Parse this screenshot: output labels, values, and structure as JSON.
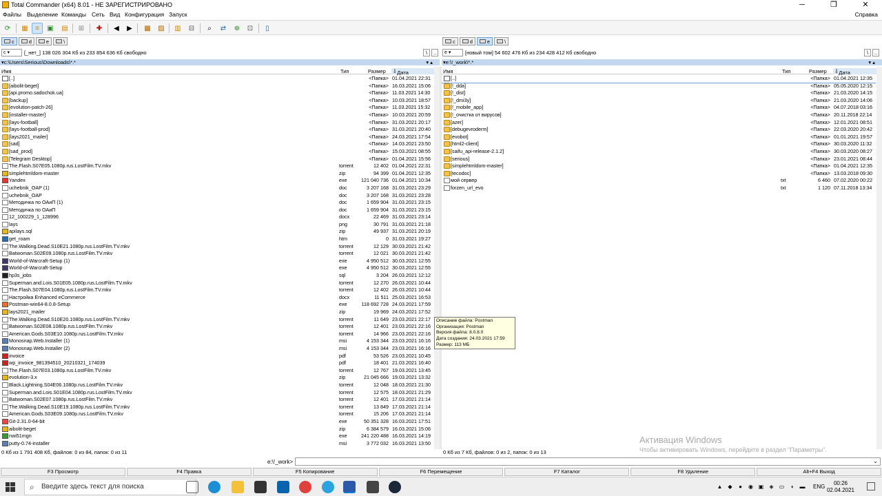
{
  "window": {
    "title": "Total Commander (x64) 8.01 - НЕ ЗАРЕГИСТРИРОВАНО",
    "minimize": "─",
    "maximize": "❐",
    "close": "✕"
  },
  "menu": [
    "Файлы",
    "Выделение",
    "Команды",
    "Сеть",
    "Вид",
    "Конфигурация",
    "Запуск"
  ],
  "help_menu": "Справка",
  "toolbar_icons": [
    "refresh-icon",
    "thumbnails-icon",
    "detail-view-icon",
    "tree-view-icon",
    "folder-sync-icon",
    "filter-icon",
    "invert-selection-icon",
    "back-arrow-icon",
    "forward-arrow-icon",
    "pack-icon",
    "unpack-icon",
    "multi-rename-icon",
    "compare-icon",
    "find-icon",
    "sync-dirs-icon",
    "ftp-icon",
    "url-icon",
    "notepad-icon"
  ],
  "left": {
    "drives": [
      "c",
      "d",
      "e",
      "\\"
    ],
    "selected_drive": "c",
    "drive_select": "c",
    "volume_info": "[_нет_]  138 026 304 Кб из 233 854 636 Кб свободно",
    "root_btn": "\\",
    "up_btn": "..",
    "path": "c:\\Users\\Serious\\Downloads\\*.*",
    "cols": {
      "name": "Имя",
      "ext": "Тип",
      "size": "Размер",
      "date": "Дата"
    },
    "rows": [
      {
        "n": "[..]",
        "e": "",
        "s": "<Папка>",
        "d": "01.04.2021 22:31",
        "t": "up"
      },
      {
        "n": "[aibolit-beget]",
        "e": "",
        "s": "<Папка>",
        "d": "16.03.2021 15:06",
        "t": "folder"
      },
      {
        "n": "[api.promo.sadochok.ua]",
        "e": "",
        "s": "<Папка>",
        "d": "11.03.2021 14:30",
        "t": "folder"
      },
      {
        "n": "[backup]",
        "e": "",
        "s": "<Папка>",
        "d": "10.03.2021 18:57",
        "t": "folder"
      },
      {
        "n": "[evolution-patch-26]",
        "e": "",
        "s": "<Папка>",
        "d": "11.03.2021 15:32",
        "t": "folder"
      },
      {
        "n": "[installer-master]",
        "e": "",
        "s": "<Папка>",
        "d": "10.03.2021 20:59",
        "t": "folder"
      },
      {
        "n": "[lays-football]",
        "e": "",
        "s": "<Папка>",
        "d": "31.03.2021 20:17",
        "t": "folder"
      },
      {
        "n": "[lays-football-prod]",
        "e": "",
        "s": "<Папка>",
        "d": "31.03.2021 20:40",
        "t": "folder"
      },
      {
        "n": "[lays2021_mailer]",
        "e": "",
        "s": "<Папка>",
        "d": "24.03.2021 17:54",
        "t": "folder"
      },
      {
        "n": "[sad]",
        "e": "",
        "s": "<Папка>",
        "d": "14.03.2021 23:50",
        "t": "folder"
      },
      {
        "n": "[sad_prod]",
        "e": "",
        "s": "<Папка>",
        "d": "15.03.2021 08:55",
        "t": "folder"
      },
      {
        "n": "[Telegram Desktop]",
        "e": "",
        "s": "<Папка>",
        "d": "01.04.2021 15:56",
        "t": "folder"
      },
      {
        "n": "The.Flash.S07E05.1080p.rus.LostFilm.TV.mkv",
        "e": "torrent",
        "s": "12 402",
        "d": "01.04.2021 22:31",
        "t": "file"
      },
      {
        "n": "simplehtmldom-master",
        "e": "zip",
        "s": "94 399",
        "d": "01.04.2021 12:35",
        "t": "zip"
      },
      {
        "n": "Yandex",
        "e": "exe",
        "s": "121 040 736",
        "d": "01.04.2021 10:34",
        "t": "yandex"
      },
      {
        "n": "uchebnik_OAP (1)",
        "e": "doc",
        "s": "3 207 168",
        "d": "31.03.2021 23:29",
        "t": "file"
      },
      {
        "n": "uchebnik_OAP",
        "e": "doc",
        "s": "3 207 168",
        "d": "31.03.2021 23:28",
        "t": "file"
      },
      {
        "n": "Методичка по ОАиП (1)",
        "e": "doc",
        "s": "1 659 904",
        "d": "31.03.2021 23:15",
        "t": "file"
      },
      {
        "n": "Методичка по ОАиП",
        "e": "doc",
        "s": "1 659 904",
        "d": "31.03.2021 23:15",
        "t": "file"
      },
      {
        "n": "12_100229_1_128996",
        "e": "docx",
        "s": "22 469",
        "d": "31.03.2021 23:14",
        "t": "file"
      },
      {
        "n": "lays",
        "e": "png",
        "s": "30 791",
        "d": "31.03.2021 21:18",
        "t": "file"
      },
      {
        "n": "apilays.sql",
        "e": "zip",
        "s": "49 937",
        "d": "31.03.2021 20:19",
        "t": "zip"
      },
      {
        "n": "get_roam",
        "e": "htm",
        "s": "0",
        "d": "31.03.2021 19:27",
        "t": "htm"
      },
      {
        "n": "The.Walking.Dead.S10E21.1080p.rus.LostFilm.TV.mkv",
        "e": "torrent",
        "s": "12 129",
        "d": "30.03.2021 21:42",
        "t": "file"
      },
      {
        "n": "Batwoman.S02E09.1080p.rus.LostFilm.TV.mkv",
        "e": "torrent",
        "s": "12 021",
        "d": "30.03.2021 21:42",
        "t": "file"
      },
      {
        "n": "World-of-Warcraft-Setup (1)",
        "e": "exe",
        "s": "4 950 512",
        "d": "30.03.2021 12:55",
        "t": "wow"
      },
      {
        "n": "World-of-Warcraft-Setup",
        "e": "exe",
        "s": "4 950 512",
        "d": "30.03.2021 12:55",
        "t": "wow"
      },
      {
        "n": "hp3s_jobs",
        "e": "sql",
        "s": "3 204",
        "d": "26.03.2021 12:12",
        "t": "sql"
      },
      {
        "n": "Superman.and.Lois.S01E05.1080p.rus.LostFilm.TV.mkv",
        "e": "torrent",
        "s": "12 270",
        "d": "26.03.2021 10:44",
        "t": "file"
      },
      {
        "n": "The.Flash.S07E04.1080p.rus.LostFilm.TV.mkv",
        "e": "torrent",
        "s": "12 402",
        "d": "26.03.2021 10:44",
        "t": "file"
      },
      {
        "n": "Настройка Enhanced eCommerce",
        "e": "docx",
        "s": "11 511",
        "d": "25.03.2021 16:53",
        "t": "file"
      },
      {
        "n": "Postman-win64-8.0.8-Setup",
        "e": "exe",
        "s": "118 692 728",
        "d": "24.03.2021 17:59",
        "t": "postman"
      },
      {
        "n": "lays2021_mailer",
        "e": "zip",
        "s": "19 969",
        "d": "24.03.2021 17:52",
        "t": "zip"
      },
      {
        "n": "The.Walking.Dead.S10E20.1080p.rus.LostFilm.TV.mkv",
        "e": "torrent",
        "s": "11 649",
        "d": "23.03.2021 22:17",
        "t": "file"
      },
      {
        "n": "Batwoman.S02E08.1080p.rus.LostFilm.TV.mkv",
        "e": "torrent",
        "s": "12 401",
        "d": "23.03.2021 22:16",
        "t": "file"
      },
      {
        "n": "American.Gods.S03E10.1080p.rus.LostFilm.TV.mkv",
        "e": "torrent",
        "s": "14 966",
        "d": "23.03.2021 22:16",
        "t": "file"
      },
      {
        "n": "Monosnap.Web.Installer (1)",
        "e": "msi",
        "s": "4 153 344",
        "d": "23.03.2021 16:16",
        "t": "msi"
      },
      {
        "n": "Monosnap.Web.Installer (2)",
        "e": "msi",
        "s": "4 153 344",
        "d": "23.03.2021 16:16",
        "t": "msi"
      },
      {
        "n": "invoice",
        "e": "pdf",
        "s": "53 526",
        "d": "23.03.2021 10:45",
        "t": "pdf"
      },
      {
        "n": "wp_invoice_981394510_20210321_174039",
        "e": "pdf",
        "s": "18 401",
        "d": "21.03.2021 16:40",
        "t": "pdf"
      },
      {
        "n": "The.Flash.S07E03.1080p.rus.LostFilm.TV.mkv",
        "e": "torrent",
        "s": "12 767",
        "d": "19.03.2021 13:45",
        "t": "file"
      },
      {
        "n": "evolution-3.x",
        "e": "zip",
        "s": "21 045 666",
        "d": "19.03.2021 13:32",
        "t": "zip"
      },
      {
        "n": "Black.Lightning.S04E06.1080p.rus.LostFilm.TV.mkv",
        "e": "torrent",
        "s": "12 048",
        "d": "18.03.2021 21:30",
        "t": "file"
      },
      {
        "n": "Superman.and.Lois.S01E04.1080p.rus.LostFilm.TV.mkv",
        "e": "torrent",
        "s": "12 575",
        "d": "18.03.2021 21:29",
        "t": "file"
      },
      {
        "n": "Batwoman.S02E07.1080p.rus.LostFilm.TV.mkv",
        "e": "torrent",
        "s": "12 401",
        "d": "17.03.2021 21:14",
        "t": "file"
      },
      {
        "n": "The.Walking.Dead.S10E19.1080p.rus.LostFilm.TV.mkv",
        "e": "torrent",
        "s": "13 849",
        "d": "17.03.2021 21:14",
        "t": "file"
      },
      {
        "n": "American.Gods.S03E09.1080p.rus.LostFilm.TV.mkv",
        "e": "torrent",
        "s": "15 206",
        "d": "17.03.2021 21:14",
        "t": "file"
      },
      {
        "n": "Git-2.31.0-64-bit",
        "e": "exe",
        "s": "50 351 328",
        "d": "16.03.2021 17:51",
        "t": "git"
      },
      {
        "n": "aibolit-beget",
        "e": "zip",
        "s": "6 384 579",
        "d": "16.03.2021 15:06",
        "t": "zip"
      },
      {
        "n": "nwi51mgn",
        "e": "exe",
        "s": "241 220 488",
        "d": "16.03.2021 14:19",
        "t": "green"
      },
      {
        "n": "putty-0.74-installer",
        "e": "msi",
        "s": "3 772 032",
        "d": "16.03.2021 13:50",
        "t": "msi"
      }
    ],
    "status": "0 Кб из 1 791 408 Кб, файлов: 0 из 84, папок: 0 из 11"
  },
  "right": {
    "drives": [
      "c",
      "d",
      "e",
      "\\"
    ],
    "selected_drive": "e",
    "drive_select": "e",
    "volume_info": "[новый том]  54 602 476 Кб из 234 428 412 Кб свободно",
    "root_btn": "\\",
    "up_btn": "..",
    "path": "e:\\!_work\\*.*",
    "cols": {
      "name": "Имя",
      "ext": "Тип",
      "size": "Размер",
      "date": "Дата"
    },
    "rows": [
      {
        "n": "[..]",
        "e": "",
        "s": "<Папка>",
        "d": "01.04.2021 12:35",
        "t": "up"
      },
      {
        "n": "[!_dda]",
        "e": "",
        "s": "<Папка>",
        "d": "05.05.2020 12:15",
        "t": "folder"
      },
      {
        "n": "[!_dist]",
        "e": "",
        "s": "<Папка>",
        "d": "21.03.2020 14:15",
        "t": "folder"
      },
      {
        "n": "[!_dmi3y]",
        "e": "",
        "s": "<Папка>",
        "d": "21.03.2020 14:06",
        "t": "folder"
      },
      {
        "n": "[!_mobile_app]",
        "e": "",
        "s": "<Папка>",
        "d": "04.07.2018 03:16",
        "t": "folder"
      },
      {
        "n": "[!_очистка от вирусов]",
        "e": "",
        "s": "<Папка>",
        "d": "20.11.2018 22:14",
        "t": "folder"
      },
      {
        "n": "[azer]",
        "e": "",
        "s": "<Папка>",
        "d": "12.01.2021 08:51",
        "t": "folder"
      },
      {
        "n": "[debugevroderm]",
        "e": "",
        "s": "<Папка>",
        "d": "22.03.2020 20:42",
        "t": "folder"
      },
      {
        "n": "[evobot]",
        "e": "",
        "s": "<Папка>",
        "d": "01.01.2021 19:57",
        "t": "folder"
      },
      {
        "n": "[html2-client]",
        "e": "",
        "s": "<Папка>",
        "d": "30.03.2020 11:32",
        "t": "folder"
      },
      {
        "n": "[saifu_api-release-2.1.2]",
        "e": "",
        "s": "<Папка>",
        "d": "30.03.2020 08:27",
        "t": "folder"
      },
      {
        "n": "[serious]",
        "e": "",
        "s": "<Папка>",
        "d": "23.01.2021 08:44",
        "t": "folder"
      },
      {
        "n": "[simplehtmldom-master]",
        "e": "",
        "s": "<Папка>",
        "d": "01.04.2021 12:35",
        "t": "folder"
      },
      {
        "n": "[tecodoc]",
        "e": "",
        "s": "<Папка>",
        "d": "13.03.2018 09:30",
        "t": "folder"
      },
      {
        "n": "мой сервер",
        "e": "txt",
        "s": "6 460",
        "d": "07.02.2020 00:22",
        "t": "file"
      },
      {
        "n": "forzen_url_evo",
        "e": "txt",
        "s": "1 120",
        "d": "07.11.2018 13:34",
        "t": "file"
      }
    ],
    "status": "0 Кб из 7 Кб, файлов: 0 из 2, папок: 0 из 13"
  },
  "cmdline": {
    "label": "e:\\!_work>",
    "value": ""
  },
  "fkeys": [
    "F3 Просмотр",
    "F4 Правка",
    "F5 Копирование",
    "F6 Перемещение",
    "F7 Каталог",
    "F8 Удаление",
    "Alt+F4 Выход"
  ],
  "tooltip": [
    "Описание файла: Postman",
    "Организация: Postman",
    "Версия файла: 8.0.8.0",
    "Дата создания: 24.03.2021 17:59",
    "Размер: 113 МБ"
  ],
  "watermark": {
    "line1": "Активация Windows",
    "line2": "Чтобы активировать Windows, перейдите в раздел \"Параметры\"."
  },
  "taskbar": {
    "search_placeholder": "Введите здесь текст для поиска",
    "time": "00:26",
    "date": "02.04.2021",
    "lang": "ENG",
    "apps": [
      "task-view-icon",
      "edge-icon",
      "file-explorer-icon",
      "mail-icon",
      "chrome-icon",
      "telegram-icon",
      "total-commander-icon",
      "utility-icon",
      "steam-icon"
    ],
    "accent": "#0078d7"
  }
}
